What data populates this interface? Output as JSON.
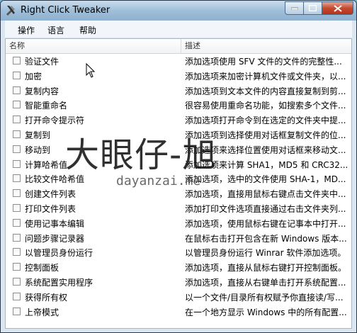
{
  "window": {
    "title": "Right Click Tweaker"
  },
  "menu": [
    "操作",
    "语言",
    "帮助"
  ],
  "columns": {
    "name": "名称",
    "desc": "描述"
  },
  "rows": [
    {
      "name": "验证文件",
      "desc": "添加选项使用 SFV 文件的文件的完整性..."
    },
    {
      "name": "加密",
      "desc": "添加选项来加密计算机文件或文件夹，以..."
    },
    {
      "name": "复制内容",
      "desc": "添加选项到文本文件的内容直接复制到剪..."
    },
    {
      "name": "智能重命名",
      "desc": "很容易使用重命名功能，如搜索多个文件..."
    },
    {
      "name": "打开命令提示符",
      "desc": "添加选项打开命令到在选定的文件夹中提..."
    },
    {
      "name": "复制到",
      "desc": "添加选项到选择使用对话框复制文件的位..."
    },
    {
      "name": "移动到",
      "desc": "添加选项来选择位置使用对话框来移动文..."
    },
    {
      "name": "计算哈希值",
      "desc": "添加选项来计算 SHA1，MD5 和 CRC32..."
    },
    {
      "name": "比较文件哈希值",
      "desc": "添加选项，选中的文件使用 SHA-1，MD..."
    },
    {
      "name": "创建文件列表",
      "desc": "添加选项，直接用鼠标右键点击文件夹中..."
    },
    {
      "name": "打印文件列表",
      "desc": "添加打印文件选项直接通过右击文件夹列..."
    },
    {
      "name": "使用记事本编辑",
      "desc": "添加选项，使用鼠标右键在记事本中打开..."
    },
    {
      "name": "问题步骤记录器",
      "desc": "在鼠标右击打开包含在新 Windows 版本..."
    },
    {
      "name": "以管理员身份运行",
      "desc": "以管理员身份运行 Winrar 软件添加选项。"
    },
    {
      "name": "控制面板",
      "desc": "添加选项，直接从鼠标右键打开控制面板。"
    },
    {
      "name": "系统配置实用程序",
      "desc": "添加选项，直接从右键单击打开系统配置..."
    },
    {
      "name": "获得所有权",
      "desc": "以一个文件/目录所有权赋予你直接读/写..."
    },
    {
      "name": "上帝模式",
      "desc": "在一个地方显示 Windows 中的所有配置..."
    }
  ],
  "watermark": {
    "text": "大眼仔-旭",
    "url": "dayanzai.me"
  }
}
